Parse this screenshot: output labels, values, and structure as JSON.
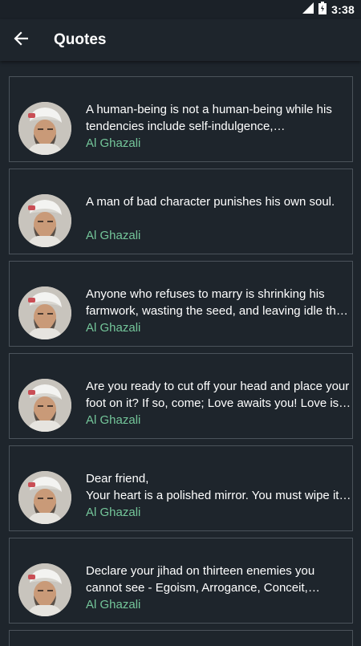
{
  "status_bar": {
    "time": "3:38",
    "icons": [
      "signal-icon",
      "battery-icon"
    ]
  },
  "toolbar": {
    "back_icon": "arrow-left-icon",
    "title": "Quotes"
  },
  "colors": {
    "background": "#1e252c",
    "card_border": "#4b535b",
    "author_accent": "#74c69a",
    "text": "#ffffff"
  },
  "quotes": [
    {
      "text": "A human-being is not a human-being while his tendencies include self-indulgence, covetousness, and anger.",
      "author": "Al Ghazali"
    },
    {
      "text": "A man of bad character punishes  his own soul.",
      "author": "Al Ghazali"
    },
    {
      "text": "Anyone who refuses to marry is shrinking his farmwork, wasting the seed, and leaving idle the instruments.",
      "author": "Al Ghazali"
    },
    {
      "text": "Are you ready to cut off your head and place your foot on it? If so, come; Love awaits you! Love is not for the weak.",
      "author": "Al Ghazali"
    },
    {
      "text": "Dear friend,\nYour heart is a polished mirror. You must wipe it clean of the veil of dust.",
      "author": "Al Ghazali"
    },
    {
      "text": "Declare your jihad on thirteen enemies you cannot see - Egoism, Arrogance, Conceit, Selfishness, Greed.",
      "author": "Al Ghazali"
    }
  ]
}
